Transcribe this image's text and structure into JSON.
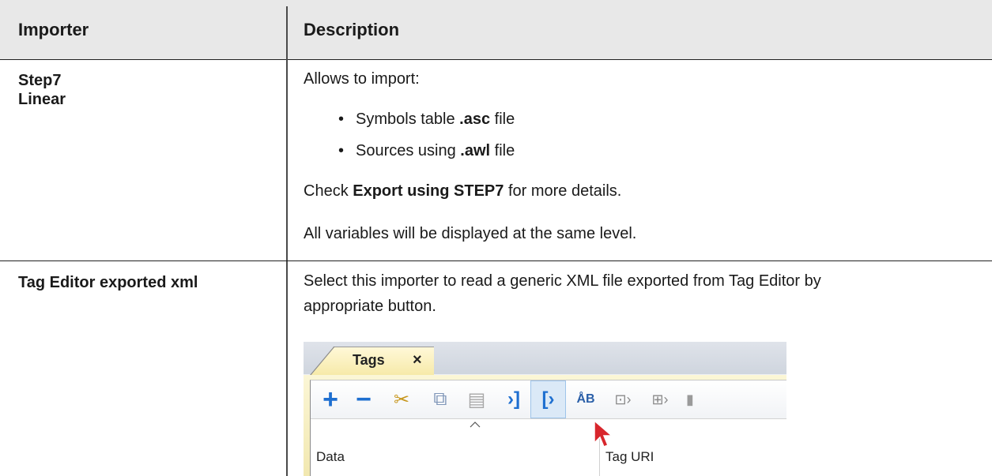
{
  "table": {
    "headers": [
      "Importer",
      "Description"
    ],
    "rows": [
      {
        "importer_lines": [
          "Step7",
          "Linear"
        ],
        "intro": "Allows to import:",
        "bullets": [
          {
            "before": "Symbols table ",
            "bold": ".asc",
            "after": " file"
          },
          {
            "before": "Sources using ",
            "bold": ".awl",
            "after": " file"
          }
        ],
        "check": {
          "before": "Check ",
          "bold": "Export using STEP7",
          "after": " for more details."
        },
        "note": "All variables will be displayed at the same level."
      },
      {
        "importer": "Tag Editor exported xml",
        "desc_line1": "Select this importer to read a generic XML file exported from Tag Editor by",
        "desc_line2": "appropriate button."
      }
    ]
  },
  "screenshot": {
    "tab_label": "Tags",
    "tab_close": "×",
    "toolbar": [
      {
        "icon": "plus-icon",
        "glyph": "+",
        "color": "#1e6fd0"
      },
      {
        "icon": "minus-icon",
        "glyph": "−",
        "color": "#1e6fd0"
      },
      {
        "icon": "scissors-icon",
        "glyph": "✂",
        "color": "#c7961c"
      },
      {
        "icon": "copy-icon",
        "glyph": "⧉",
        "color": "#7f96b8"
      },
      {
        "icon": "paste-icon",
        "glyph": "▤",
        "color": "#a7a7a7"
      },
      {
        "icon": "import-icon",
        "glyph": "›]",
        "color": "#1e6fd0"
      },
      {
        "icon": "export-icon",
        "glyph": "[›",
        "color": "#1e6fd0",
        "active": true
      },
      {
        "icon": "sort-ab-icon",
        "glyph": "ÅB",
        "color": "#2a5fa8"
      },
      {
        "icon": "rename-icon",
        "glyph": "⊡›",
        "color": "#8a8a8a"
      },
      {
        "icon": "add-rename-icon",
        "glyph": "⊞›",
        "color": "#8a8a8a"
      },
      {
        "icon": "more-icon",
        "glyph": "▮",
        "color": "#9a9a9a"
      }
    ],
    "columns": [
      "Data",
      "Tag URI"
    ],
    "colors": {
      "accent": "#1e6fd0",
      "header_bg": "#e8e8e8"
    }
  }
}
